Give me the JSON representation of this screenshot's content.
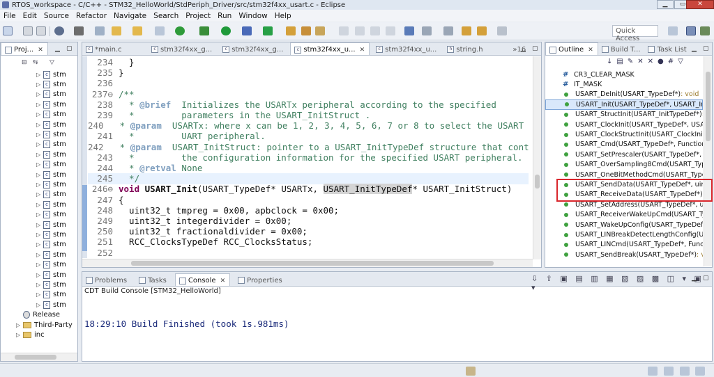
{
  "window": {
    "title": "RTOS_workspace - C/C++ - STM32_HelloWorld/StdPeriph_Driver/src/stm32f4xx_usart.c - Eclipse"
  },
  "menu": [
    "File",
    "Edit",
    "Source",
    "Refactor",
    "Navigate",
    "Search",
    "Project",
    "Run",
    "Window",
    "Help"
  ],
  "toolbar": {
    "quick_access": "Quick Access"
  },
  "project_explorer": {
    "tab_label": "Proj...",
    "items": [
      {
        "label": "stm",
        "icon": "c"
      },
      {
        "label": "stm",
        "icon": "c"
      },
      {
        "label": "stm",
        "icon": "c"
      },
      {
        "label": "stm",
        "icon": "c"
      },
      {
        "label": "stm",
        "icon": "c"
      },
      {
        "label": "stm",
        "icon": "c"
      },
      {
        "label": "stm",
        "icon": "c"
      },
      {
        "label": "stm",
        "icon": "c"
      },
      {
        "label": "stm",
        "icon": "c"
      },
      {
        "label": "stm",
        "icon": "c"
      },
      {
        "label": "stm",
        "icon": "c"
      },
      {
        "label": "stm",
        "icon": "c"
      },
      {
        "label": "stm",
        "icon": "c"
      },
      {
        "label": "stm",
        "icon": "c"
      },
      {
        "label": "stm",
        "icon": "c"
      },
      {
        "label": "stm",
        "icon": "c"
      },
      {
        "label": "stm",
        "icon": "c"
      },
      {
        "label": "stm",
        "icon": "c"
      },
      {
        "label": "stm",
        "icon": "c"
      },
      {
        "label": "stm",
        "icon": "c"
      },
      {
        "label": "stm",
        "icon": "c"
      },
      {
        "label": "stm",
        "icon": "c"
      },
      {
        "label": "stm",
        "icon": "c"
      },
      {
        "label": "stm",
        "icon": "c"
      },
      {
        "label": "Release",
        "icon": "gear"
      },
      {
        "label": "Third-Party",
        "icon": "folder"
      },
      {
        "label": "inc",
        "icon": "folder"
      }
    ]
  },
  "editor": {
    "tabs": [
      {
        "label": "*main.c",
        "active": false
      },
      {
        "label": "stm32f4xx_g...",
        "active": false
      },
      {
        "label": "stm32f4xx_g...",
        "active": false
      },
      {
        "label": "stm32f4xx_u...",
        "active": true
      },
      {
        "label": "stm32f4xx_u...",
        "active": false
      },
      {
        "label": "string.h",
        "active": false
      },
      {
        "label": "»16",
        "active": false
      }
    ],
    "lines": [
      {
        "num": "234",
        "text": "  }"
      },
      {
        "num": "235",
        "text": "}"
      },
      {
        "num": "236",
        "text": ""
      },
      {
        "num": "237⊖",
        "text": "/**"
      },
      {
        "num": "238",
        "text": "  * @brief  Initializes the USARTx peripheral according to the specified"
      },
      {
        "num": "239",
        "text": "  *         parameters in the USART_InitStruct ."
      },
      {
        "num": "240",
        "text": "  * @param  USARTx: where x can be 1, 2, 3, 4, 5, 6, 7 or 8 to select the USART o"
      },
      {
        "num": "241",
        "text": "  *         UART peripheral."
      },
      {
        "num": "242",
        "text": "  * @param  USART_InitStruct: pointer to a USART_InitTypeDef structure that conta"
      },
      {
        "num": "243",
        "text": "  *         the configuration information for the specified USART peripheral."
      },
      {
        "num": "244",
        "text": "  * @retval None"
      },
      {
        "num": "245",
        "text": "  */"
      },
      {
        "num": "246⊖",
        "text": "void USART_Init(USART_TypeDef* USARTx, USART_InitTypeDef* USART_InitStruct)"
      },
      {
        "num": "247",
        "text": "{"
      },
      {
        "num": "248",
        "text": "  uint32_t tmpreg = 0x00, apbclock = 0x00;"
      },
      {
        "num": "249",
        "text": "  uint32_t integerdivider = 0x00;"
      },
      {
        "num": "250",
        "text": "  uint32_t fractionaldivider = 0x00;"
      },
      {
        "num": "251",
        "text": "  RCC_ClocksTypeDef RCC_ClocksStatus;"
      },
      {
        "num": "252",
        "text": ""
      }
    ]
  },
  "outline": {
    "tabs": [
      "Outline",
      "Build T...",
      "Task List"
    ],
    "items": [
      {
        "label": "CR3_CLEAR_MASK",
        "kind": "macro"
      },
      {
        "label": "IT_MASK",
        "kind": "macro"
      },
      {
        "label": "USART_DeInit(USART_TypeDef*)",
        "ret": " : void",
        "kind": "fn"
      },
      {
        "label": "USART_Init(USART_TypeDef*, USART_InitTyp",
        "ret": "",
        "kind": "fn",
        "selected": true
      },
      {
        "label": "USART_StructInit(USART_InitTypeDef*)",
        "ret": " : voi",
        "kind": "fn"
      },
      {
        "label": "USART_ClockInit(USART_TypeDef*, USART_",
        "ret": "",
        "kind": "fn"
      },
      {
        "label": "USART_ClockStructInit(USART_ClockInitTyp",
        "ret": "",
        "kind": "fn"
      },
      {
        "label": "USART_Cmd(USART_TypeDef*, Functional",
        "ret": "",
        "kind": "fn"
      },
      {
        "label": "USART_SetPrescaler(USART_TypeDef*, uint",
        "ret": "",
        "kind": "fn"
      },
      {
        "label": "USART_OverSampling8Cmd(USART_TypeD",
        "ret": "",
        "kind": "fn"
      },
      {
        "label": "USART_OneBitMethodCmd(USART_TypeD",
        "ret": "",
        "kind": "fn"
      },
      {
        "label": "USART_SendData(USART_TypeDef*, uint16",
        "ret": "",
        "kind": "fn"
      },
      {
        "label": "USART_ReceiveData(USART_TypeDef*)",
        "ret": " : uint16_",
        "kind": "fn"
      },
      {
        "label": "USART_SetAddress(USART_TypeDef*, uint8",
        "ret": "",
        "kind": "fn"
      },
      {
        "label": "USART_ReceiverWakeUpCmd(USART_Type",
        "ret": "",
        "kind": "fn"
      },
      {
        "label": "USART_WakeUpConfig(USART_TypeDef*, u",
        "ret": "",
        "kind": "fn"
      },
      {
        "label": "USART_LINBreakDetectLengthConfig(USAR",
        "ret": "",
        "kind": "fn"
      },
      {
        "label": "USART_LINCmd(USART_TypeDef*, Functio",
        "ret": "",
        "kind": "fn"
      },
      {
        "label": "USART_SendBreak(USART_TypeDef*)",
        "ret": " : void",
        "kind": "fn"
      }
    ]
  },
  "bottom": {
    "tabs": [
      "Problems",
      "Tasks",
      "Console",
      "Properties"
    ],
    "console_title": "CDT Build Console [STM32_HelloWorld]",
    "console_output": "18:29:10 Build Finished (took 1s.981ms)"
  },
  "colors": {
    "keyword": "#7f0055",
    "comment": "#3f7f5f",
    "highlight_box": "#d9262c"
  }
}
